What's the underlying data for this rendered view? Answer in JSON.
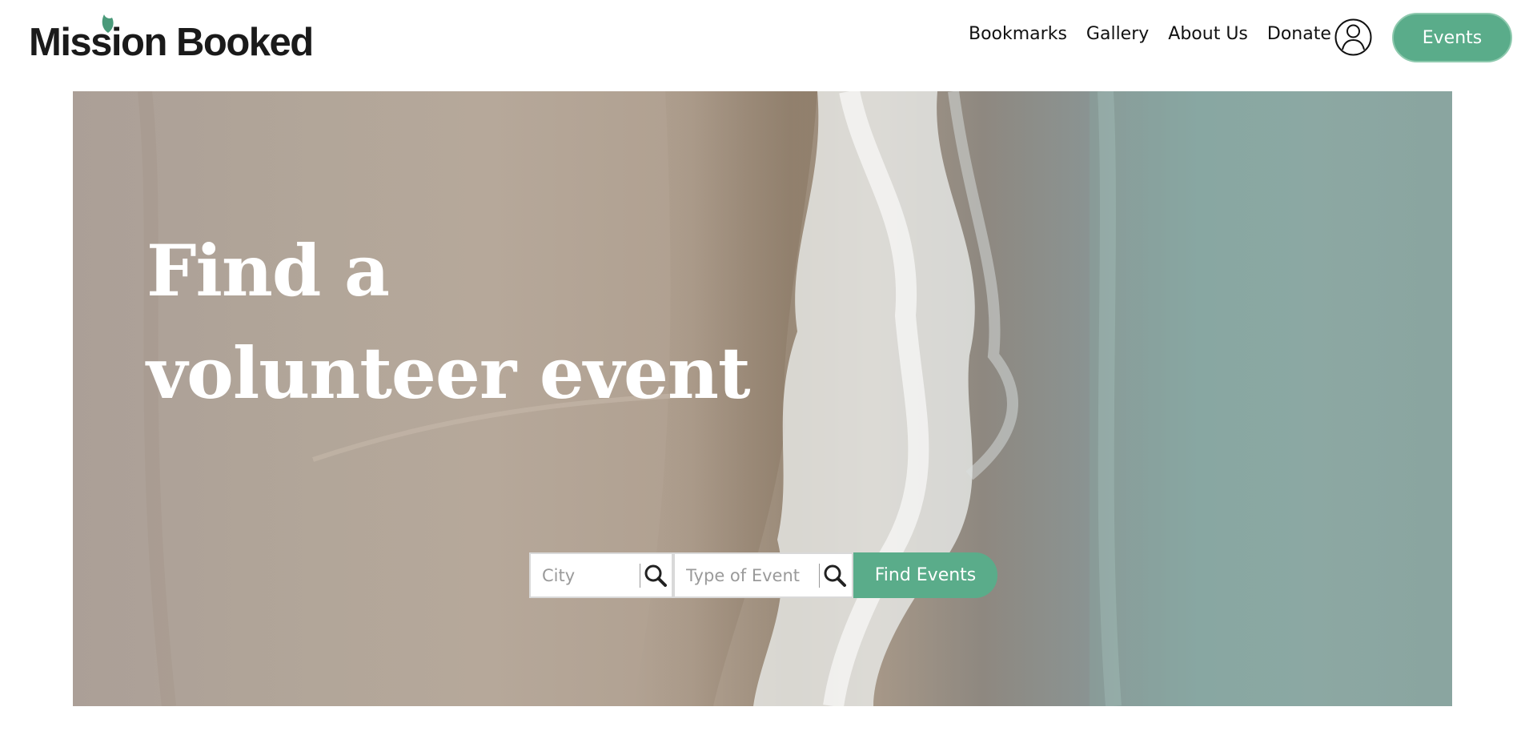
{
  "header": {
    "logo": "Mission Booked",
    "nav": [
      {
        "label": "Bookmarks"
      },
      {
        "label": "Gallery"
      },
      {
        "label": "About Us"
      },
      {
        "label": "Donate"
      }
    ],
    "account_icon": "user-icon",
    "events_label": "Events"
  },
  "hero": {
    "title": "Find a volunteer event",
    "search": {
      "city_placeholder": "City",
      "type_placeholder": "Type of Event",
      "button_label": "Find Events",
      "icon": "search-icon"
    }
  },
  "colors": {
    "accent": "#5aac8a",
    "logo_leaf": "#4a9a7a",
    "text": "#111111"
  }
}
